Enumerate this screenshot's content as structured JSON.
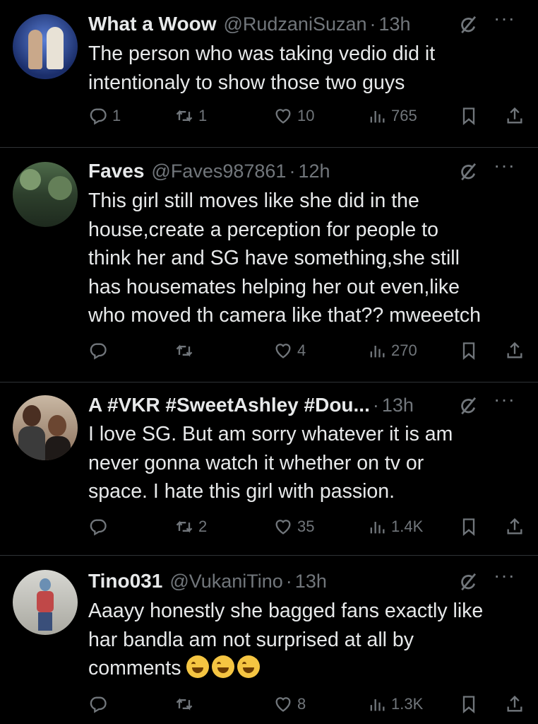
{
  "tweets": [
    {
      "name": "What a Woow",
      "handle": "@RudzaniSuzan",
      "dot": "·",
      "time": "13h",
      "more": "···",
      "text_lines": [
        "The person who was taking vedio did it",
        "intentionaly to show those two guys"
      ],
      "replies": "1",
      "retweets": "1",
      "likes": "10",
      "views": "765"
    },
    {
      "name": "Faves",
      "handle": "@Faves987861",
      "dot": "·",
      "time": "12h",
      "more": "···",
      "text_lines": [
        "This girl still moves like she did in the",
        "house,create a perception for people to",
        "think her and SG have something,she still",
        "has housemates helping her out even,like",
        "who moved th camera like that?? mweeetch"
      ],
      "replies": "",
      "retweets": "",
      "likes": "4",
      "views": "270"
    },
    {
      "name": "A #VKR #SweetAshley #Dou...",
      "handle": "",
      "dot": "·",
      "time": "13h",
      "more": "···",
      "text_lines": [
        "I love SG. But am sorry whatever it is am",
        "never gonna watch it whether on tv or",
        "space. I hate this girl with passion."
      ],
      "replies": "",
      "retweets": "2",
      "likes": "35",
      "views": "1.4K"
    },
    {
      "name": "Tino031",
      "handle": "@VukaniTino",
      "dot": "·",
      "time": "13h",
      "more": "···",
      "text_lines": [
        "Aaayy honestly she bagged fans exactly like",
        "har bandla am not surprised at all by",
        "comments"
      ],
      "emojis": [
        "rolling-on-floor-laughing",
        "rolling-on-floor-laughing",
        "rolling-on-floor-laughing"
      ],
      "replies": "",
      "retweets": "",
      "likes": "8",
      "views": "1.3K"
    }
  ],
  "colors": {
    "background": "#000000",
    "text": "#e7e9ea",
    "muted": "#71767b",
    "divider": "#2f3336"
  }
}
